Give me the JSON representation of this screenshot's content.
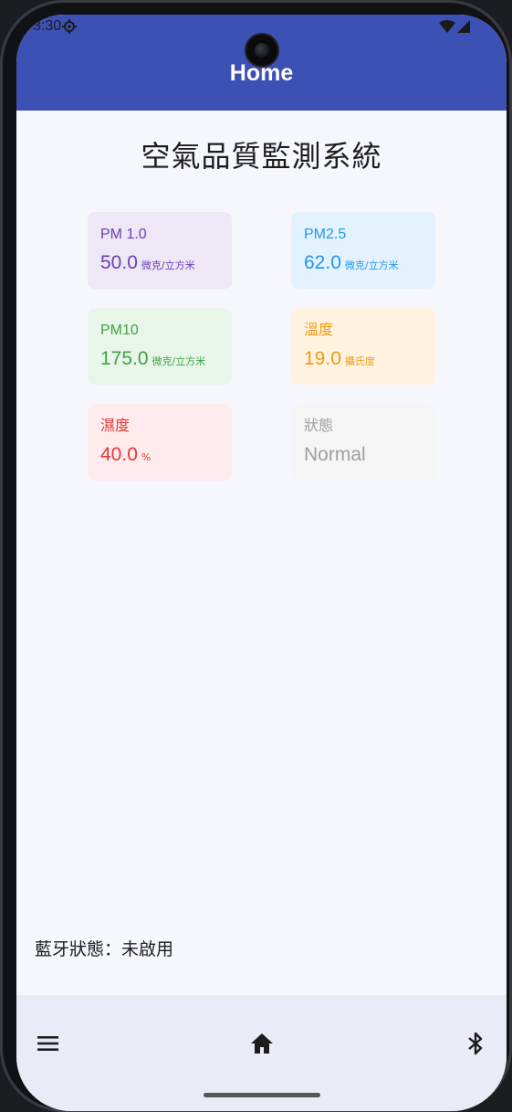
{
  "status_bar": {
    "time": "3:30"
  },
  "app_bar": {
    "title": "Home"
  },
  "page_title": "空氣品質監測系統",
  "cards": [
    {
      "label": "PM 1.0",
      "value": "50.0",
      "unit": "微克/立方米",
      "color": "#6a3fb0",
      "bg": "#ede7f6"
    },
    {
      "label": "PM2.5",
      "value": "62.0",
      "unit": "微克/立方米",
      "color": "#2196f3",
      "bg": "#e3f2fd"
    },
    {
      "label": "PM10",
      "value": "175.0",
      "unit": "微克/立方米",
      "color": "#43a047",
      "bg": "#e8f5e9"
    },
    {
      "label": "溫度",
      "value": "19.0",
      "unit": "攝氏度",
      "color": "#f29a12",
      "bg": "#fff3e0"
    },
    {
      "label": "濕度",
      "value": "40.0",
      "unit": "%",
      "color": "#e53935",
      "bg": "#ffebee"
    },
    {
      "label": "狀態",
      "value": "Normal",
      "unit": "",
      "color": "#9e9e9e",
      "bg": "#f5f5f5"
    }
  ],
  "bluetooth_status": "藍牙狀態：未啟用",
  "bottom_nav": {
    "items": [
      {
        "icon": "menu-icon"
      },
      {
        "icon": "home-icon"
      },
      {
        "icon": "bluetooth-icon"
      }
    ]
  }
}
